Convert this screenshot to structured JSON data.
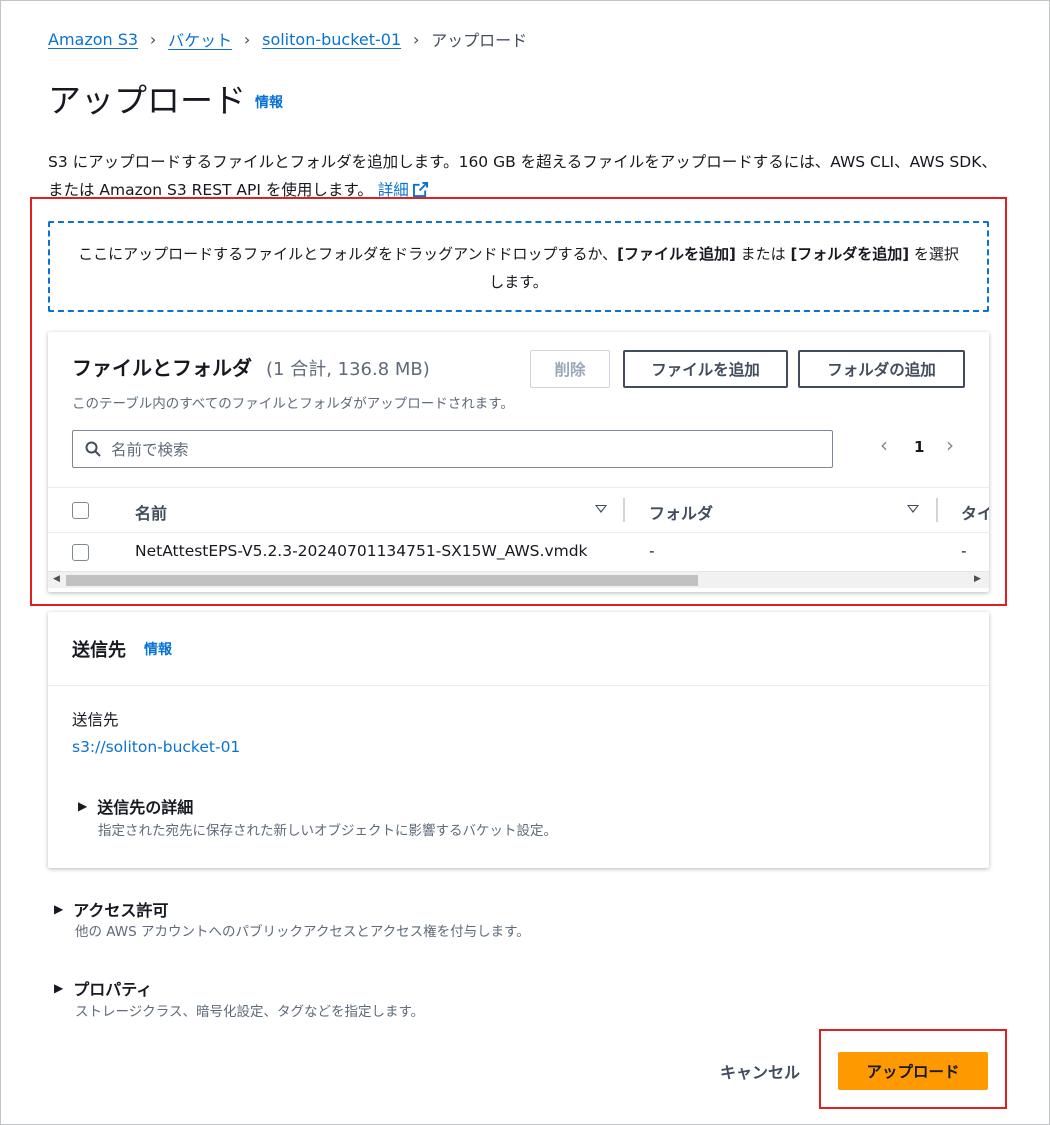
{
  "breadcrumb": {
    "items": [
      "Amazon S3",
      "バケット",
      "soliton-bucket-01"
    ],
    "current": "アップロード"
  },
  "page": {
    "title": "アップロード",
    "info": "情報",
    "description": "S3 にアップロードするファイルとフォルダを追加します。160 GB を超えるファイルをアップロードするには、AWS CLI、AWS SDK、または Amazon S3 REST API を使用します。",
    "details_link": "詳細"
  },
  "dropzone": {
    "text_prefix": "ここにアップロードするファイルとフォルダをドラッグアンドドロップするか、",
    "add_files": "[ファイルを追加]",
    "or": " または ",
    "add_folder": "[フォルダを追加]",
    "suffix": " を選択します。"
  },
  "files": {
    "title": "ファイルとフォルダ",
    "count": "(1 合計, 136.8 MB)",
    "subtitle": "このテーブル内のすべてのファイルとフォルダがアップロードされます。",
    "remove_label": "削除",
    "add_files_label": "ファイルを追加",
    "add_folder_label": "フォルダの追加",
    "search_placeholder": "名前で検索",
    "page_number": "1",
    "columns": [
      "名前",
      "フォルダ",
      "タイ"
    ],
    "rows": [
      {
        "name": "NetAttestEPS-V5.2.3-20240701134751-SX15W_AWS.vmdk",
        "folder": "-",
        "type": "-"
      }
    ]
  },
  "destination": {
    "title": "送信先",
    "info": "情報",
    "label": "送信先",
    "value": "s3://soliton-bucket-01",
    "details_title": "送信先の詳細",
    "details_desc": "指定された宛先に保存された新しいオブジェクトに影響するバケット設定。"
  },
  "permissions": {
    "title": "アクセス許可",
    "desc": "他の AWS アカウントへのパブリックアクセスとアクセス権を付与します。"
  },
  "properties": {
    "title": "プロパティ",
    "desc": "ストレージクラス、暗号化設定、タグなどを指定します。"
  },
  "footer": {
    "cancel_label": "キャンセル",
    "upload_label": "アップロード"
  },
  "colors": {
    "link": "#0972d3",
    "primary_button": "#ff9900",
    "highlight_box": "#e02020"
  }
}
